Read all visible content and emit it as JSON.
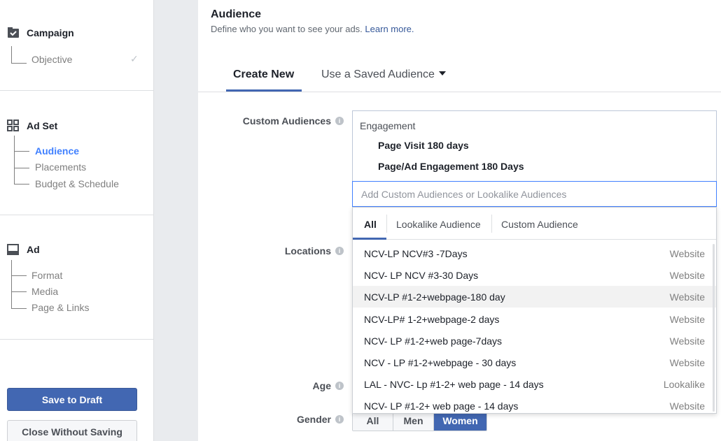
{
  "sidebar": {
    "campaign": {
      "title": "Campaign",
      "items": [
        {
          "label": "Objective"
        }
      ]
    },
    "ad_set": {
      "title": "Ad Set",
      "items": [
        {
          "label": "Audience"
        },
        {
          "label": "Placements"
        },
        {
          "label": "Budget & Schedule"
        }
      ]
    },
    "ad": {
      "title": "Ad",
      "items": [
        {
          "label": "Format"
        },
        {
          "label": "Media"
        },
        {
          "label": "Page & Links"
        }
      ]
    },
    "save_draft_label": "Save to Draft",
    "close_label": "Close Without Saving"
  },
  "main": {
    "title": "Audience",
    "subtitle": "Define who you want to see your ads.",
    "learn_more": "Learn more.",
    "tabs": {
      "create_new": "Create New",
      "saved": "Use a Saved Audience"
    },
    "labels": {
      "custom_audiences": "Custom Audiences",
      "locations": "Locations",
      "age": "Age",
      "gender": "Gender"
    },
    "custom_audiences": {
      "category": "Engagement",
      "selected": [
        "Page Visit 180 days",
        "Page/Ad Engagement 180 Days"
      ],
      "input_placeholder": "Add Custom Audiences or Lookalike Audiences"
    },
    "dropdown": {
      "tabs": [
        "All",
        "Lookalike Audience",
        "Custom Audience"
      ],
      "rows": [
        {
          "name": "NCV-LP NCV#3 -7Days",
          "type": "Website"
        },
        {
          "name": "NCV- LP NCV #3-30 Days",
          "type": "Website"
        },
        {
          "name": "NCV-LP #1-2+webpage-180 day",
          "type": "Website"
        },
        {
          "name": "NCV-LP# 1-2+webpage-2 days",
          "type": "Website"
        },
        {
          "name": "NCV- LP #1-2+web page-7days",
          "type": "Website"
        },
        {
          "name": "NCV - LP #1-2+webpage - 30 days",
          "type": "Website"
        },
        {
          "name": "LAL - NVC- Lp #1-2+ web page - 14 days",
          "type": "Lookalike"
        },
        {
          "name": "NCV- LP #1-2+ web page - 14 days",
          "type": "Website"
        }
      ]
    },
    "gender": {
      "options": [
        "All",
        "Men",
        "Women"
      ],
      "selected": "Women"
    }
  },
  "colors": {
    "accent": "#4267b2",
    "active_link": "#4080ff",
    "gutter": "#e9ebee"
  }
}
